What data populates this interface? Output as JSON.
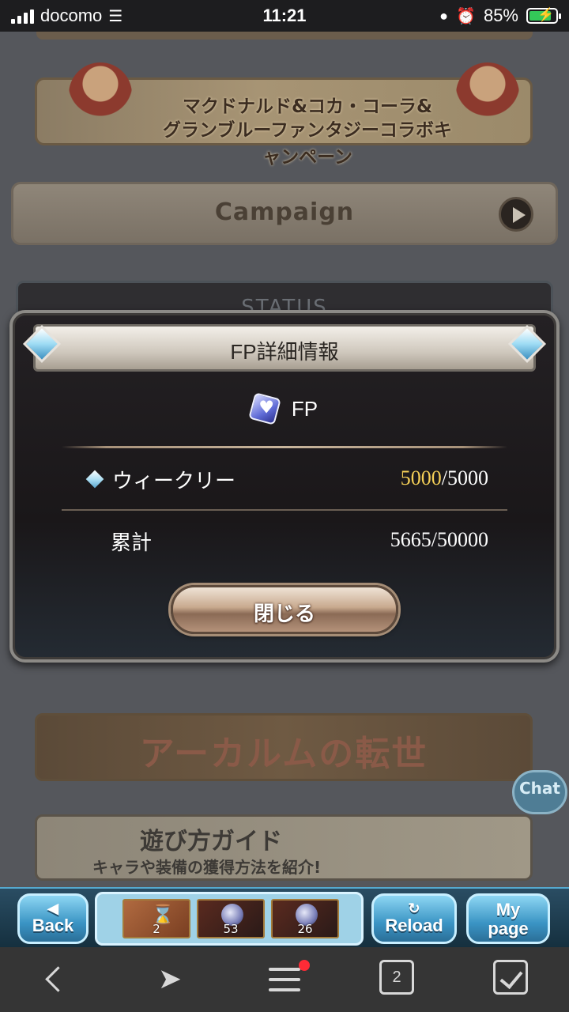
{
  "status_bar": {
    "carrier": "docomo",
    "time": "11:21",
    "battery_percent": "85%"
  },
  "background": {
    "collab_banner": {
      "line1": "マクドナルド&コカ・コーラ&",
      "line2": "グランブルーファンタジーコラボキャンペーン"
    },
    "campaign_button": "Campaign",
    "status_panel_title": "STATUS",
    "arcarum_banner": "アーカルムの転世",
    "guide_banner": {
      "title": "遊び方ガイド",
      "subtitle": "キャラや装備の獲得方法を紹介!"
    },
    "chat_bubble": "Chat"
  },
  "modal": {
    "title": "FP詳細情報",
    "currency_label": "FP",
    "rows": [
      {
        "label": "ウィークリー",
        "current": "5000",
        "max": "/5000"
      },
      {
        "label": "累計",
        "value": "5665/50000"
      }
    ],
    "close_button": "閉じる"
  },
  "game_bar": {
    "back": "Back",
    "reload": "Reload",
    "mypage_line1": "My",
    "mypage_line2": "page",
    "slots": [
      {
        "count": "2"
      },
      {
        "count": "53"
      },
      {
        "count": "26"
      }
    ]
  },
  "browser_bar": {
    "tab_count": "2",
    "has_notification": true
  },
  "colors": {
    "accent_gold": "#f5cf57",
    "notification_red": "#ff2b36",
    "battery_green": "#34c759"
  }
}
